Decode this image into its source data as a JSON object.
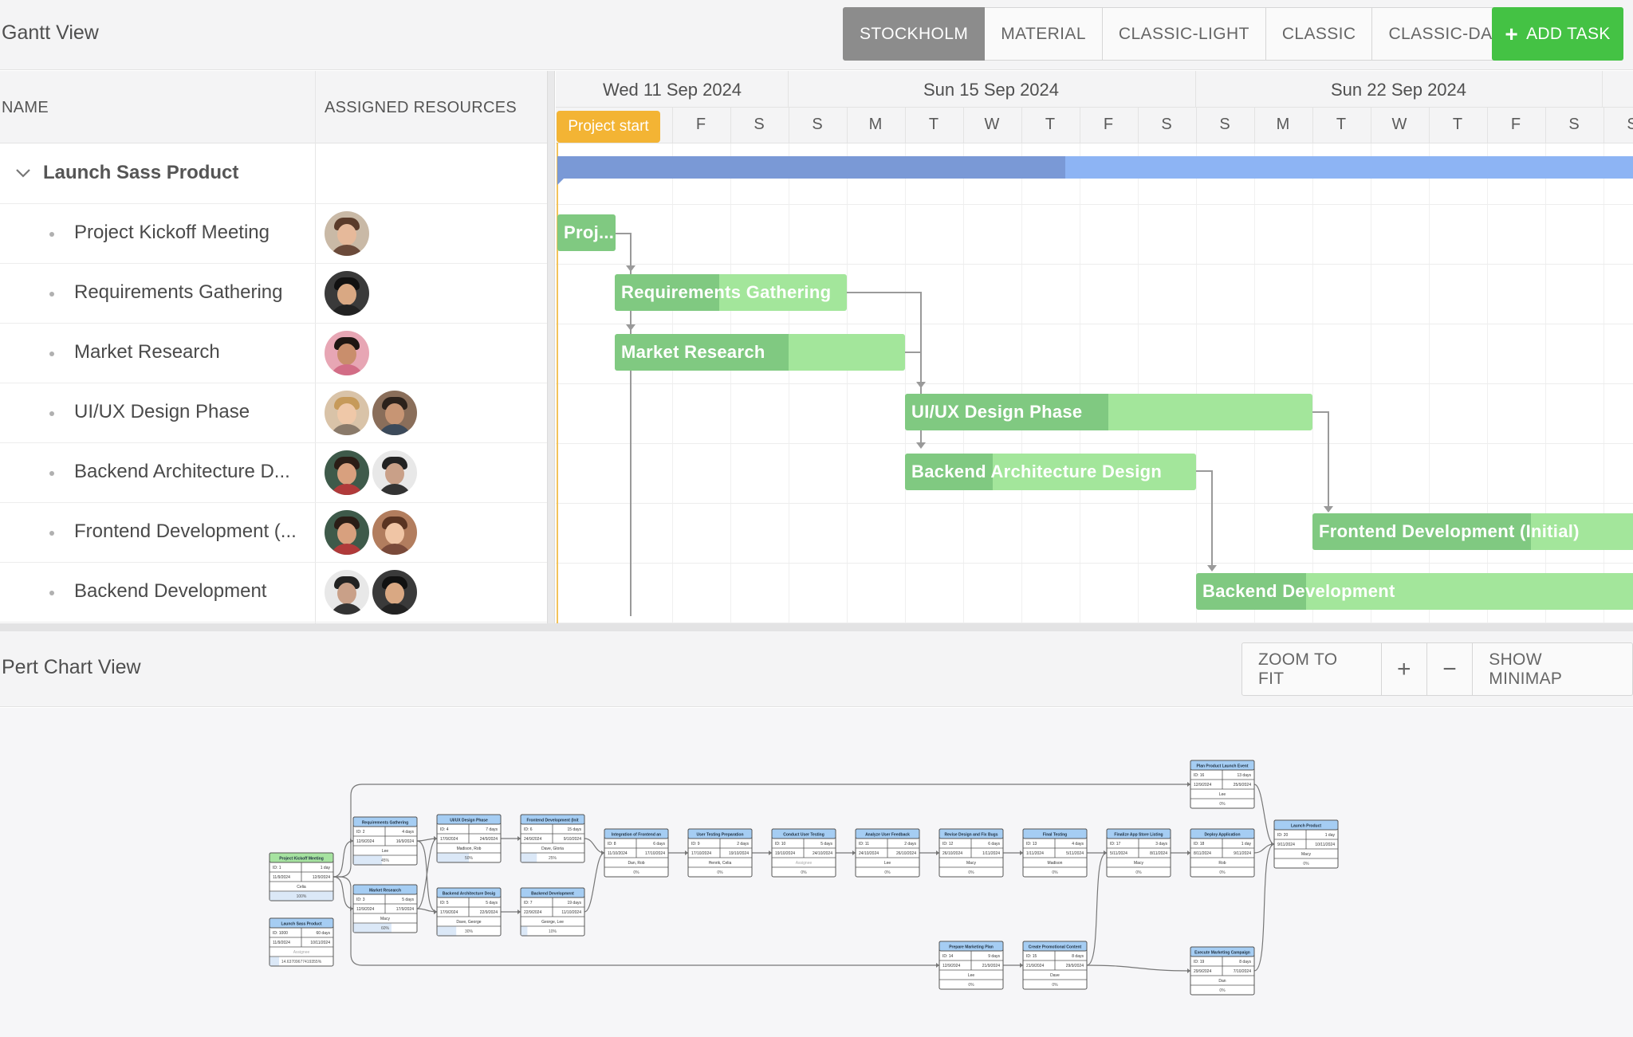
{
  "gantt": {
    "title": "Gantt View",
    "themes": [
      "STOCKHOLM",
      "MATERIAL",
      "CLASSIC-LIGHT",
      "CLASSIC",
      "CLASSIC-DARK"
    ],
    "active_theme": "STOCKHOLM",
    "add_task_label": "ADD TASK",
    "columns": {
      "name": "NAME",
      "resources": "ASSIGNED RESOURCES"
    },
    "parent_task": "Launch Sass Product",
    "tasks": [
      {
        "name": "Project Kickoff Meeting",
        "bar_label": "Proj...",
        "progress": 1.0
      },
      {
        "name": "Requirements Gathering",
        "bar_label": "Requirements Gathering",
        "progress": 0.45
      },
      {
        "name": "Market Research",
        "bar_label": "Market Research",
        "progress": 0.6
      },
      {
        "name": "UI/UX Design Phase",
        "bar_label": "UI/UX Design Phase",
        "progress": 0.5
      },
      {
        "name": "Backend Architecture D...",
        "bar_label": "Backend Architecture Design",
        "progress": 0.3
      },
      {
        "name": "Frontend Development (...",
        "bar_label": "Frontend Development (Initial)",
        "progress": 0.25
      },
      {
        "name": "Backend Development",
        "bar_label": "Backend Development",
        "progress": 0.1
      }
    ],
    "weeks": [
      "Wed 11 Sep 2024",
      "Sun 15 Sep 2024",
      "Sun 22 Sep 2024"
    ],
    "days": [
      "F",
      "S",
      "S",
      "M",
      "T",
      "W",
      "T",
      "F",
      "S",
      "S",
      "M",
      "T",
      "W",
      "T",
      "F",
      "S",
      "S"
    ],
    "project_start_label": "Project start",
    "summary_progress": 0.47
  },
  "pert": {
    "title": "Pert Chart View",
    "zoom_to_fit_label": "ZOOM TO FIT",
    "zoom_in_label": "+",
    "zoom_out_label": "−",
    "minimap_label": "SHOW MINIMAP",
    "nodes": [
      {
        "title": "Project Kickoff Meeting",
        "id": "ID: 1",
        "dur": "1 day",
        "start": "11/9/2024",
        "end": "12/9/2024",
        "res": "Celia",
        "pct": "100%",
        "done": true
      },
      {
        "title": "Launch Sass Product",
        "id": "ID: 1000",
        "dur": "60 days",
        "start": "11/9/2024",
        "end": "10/11/2024",
        "res": "Assignee",
        "pct": "14.63709677419355%"
      },
      {
        "title": "Requirements Gathering",
        "id": "ID: 2",
        "dur": "4 days",
        "start": "12/9/2024",
        "end": "16/9/2024",
        "res": "Lee",
        "pct": "45%"
      },
      {
        "title": "Market Research",
        "id": "ID: 3",
        "dur": "5 days",
        "start": "12/9/2024",
        "end": "17/9/2024",
        "res": "Macy",
        "pct": "60%"
      },
      {
        "title": "UI/UX Design Phase",
        "id": "ID: 4",
        "dur": "7 days",
        "start": "17/9/2024",
        "end": "24/9/2024",
        "res": "Madison, Rob",
        "pct": "50%"
      },
      {
        "title": "Backend Architecture Design",
        "id": "ID: 5",
        "dur": "5 days",
        "start": "17/9/2024",
        "end": "22/9/2024",
        "res": "Dave, George",
        "pct": "30%"
      },
      {
        "title": "Frontend Development (Initial)",
        "id": "ID: 6",
        "dur": "15 days",
        "start": "24/9/2024",
        "end": "9/10/2024",
        "res": "Dave, Gloria",
        "pct": "25%"
      },
      {
        "title": "Backend Development",
        "id": "ID: 7",
        "dur": "19 days",
        "start": "22/9/2024",
        "end": "11/10/2024",
        "res": "George, Lee",
        "pct": "10%"
      },
      {
        "title": "Integration of Frontend and Backend",
        "id": "ID: 8",
        "dur": "6 days",
        "start": "11/10/2024",
        "end": "17/10/2024",
        "res": "Dan, Rob",
        "pct": "0%"
      },
      {
        "title": "User Testing Preparation",
        "id": "ID: 9",
        "dur": "2 days",
        "start": "17/10/2024",
        "end": "19/10/2024",
        "res": "Henrik, Celia",
        "pct": "0%"
      },
      {
        "title": "Conduct User Testing",
        "id": "ID: 10",
        "dur": "5 days",
        "start": "19/10/2024",
        "end": "24/10/2024",
        "res": "Assignee",
        "pct": "0%"
      },
      {
        "title": "Analyze User Feedback",
        "id": "ID: 11",
        "dur": "2 days",
        "start": "24/10/2024",
        "end": "26/10/2024",
        "res": "Lee",
        "pct": "0%"
      },
      {
        "title": "Revise Design and Fix Bugs",
        "id": "ID: 12",
        "dur": "6 days",
        "start": "26/10/2024",
        "end": "1/11/2024",
        "res": "Macy",
        "pct": "0%"
      },
      {
        "title": "Final Testing",
        "id": "ID: 13",
        "dur": "4 days",
        "start": "1/11/2024",
        "end": "5/11/2024",
        "res": "Madison",
        "pct": "0%"
      },
      {
        "title": "Finalize App Store Listings",
        "id": "ID: 17",
        "dur": "3 days",
        "start": "5/11/2024",
        "end": "8/11/2024",
        "res": "Macy",
        "pct": "0%"
      },
      {
        "title": "Deploy Application",
        "id": "ID: 18",
        "dur": "1 day",
        "start": "8/11/2024",
        "end": "9/11/2024",
        "res": "Rob",
        "pct": "0%"
      },
      {
        "title": "Plan Product Launch Event",
        "id": "ID: 16",
        "dur": "13 days",
        "start": "12/9/2024",
        "end": "25/9/2024",
        "res": "Lee",
        "pct": "0%"
      },
      {
        "title": "Launch Product",
        "id": "ID: 20",
        "dur": "1 day",
        "start": "9/11/2024",
        "end": "10/11/2024",
        "res": "Macy",
        "pct": "0%"
      },
      {
        "title": "Prepare Marketing Plan",
        "id": "ID: 14",
        "dur": "9 days",
        "start": "12/9/2024",
        "end": "21/9/2024",
        "res": "Lee",
        "pct": "0%"
      },
      {
        "title": "Create Promotional Content",
        "id": "ID: 15",
        "dur": "8 days",
        "start": "21/9/2024",
        "end": "29/9/2024",
        "res": "Dave",
        "pct": "0%"
      },
      {
        "title": "Execute Marketing Campaign",
        "id": "ID: 19",
        "dur": "8 days",
        "start": "29/9/2024",
        "end": "7/10/2024",
        "res": "Dan",
        "pct": "0%"
      }
    ]
  },
  "colors": {
    "accent_green": "#44c244",
    "task_bar": "#a3e69b",
    "task_progress": "#80c981",
    "summary_bar": "#8db4f4",
    "milestone": "#f3b434",
    "pert_header_blue": "#a5cdf3",
    "pert_header_green": "#a6e3a0"
  }
}
